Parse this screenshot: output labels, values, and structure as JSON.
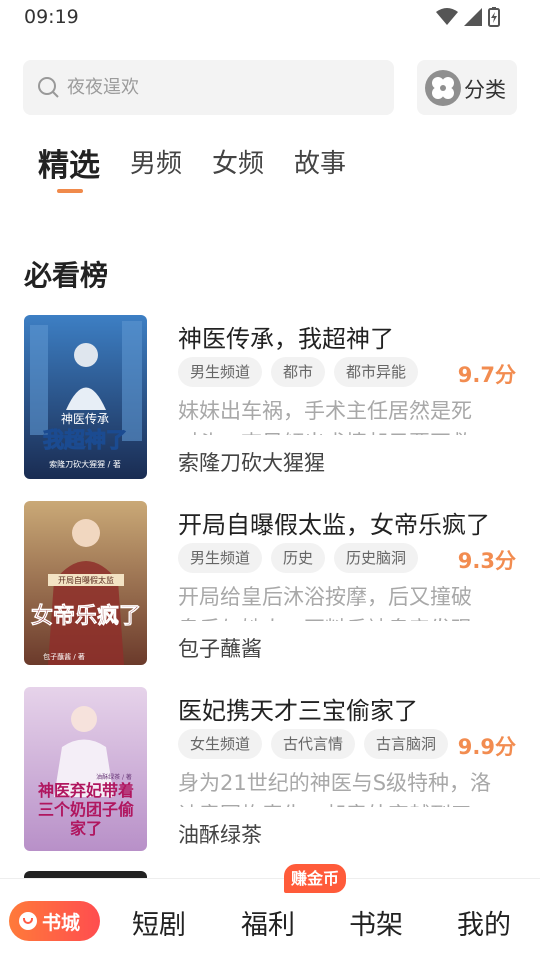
{
  "status_bar": {
    "time": "09:19"
  },
  "search": {
    "placeholder": "夜夜逞欢"
  },
  "category_button": {
    "label": "分类"
  },
  "tabs": [
    {
      "label": "精选"
    },
    {
      "label": "男频"
    },
    {
      "label": "女频"
    },
    {
      "label": "故事"
    }
  ],
  "section": {
    "title": "必看榜"
  },
  "books": [
    {
      "title": "神医传承，我超神了",
      "tags": [
        "男生频道",
        "都市",
        "都市异能"
      ],
      "score": "9.7分",
      "desc_line1": "妹妹出车祸，手术主任居然是死",
      "desc_line2": "对头，李风倾出求情却只要不救",
      "author": "索隆刀砍大猩猩",
      "cover_title": "我超神了",
      "cover_subtitle": "神医传承",
      "cover_author": "索隆刀砍大猩猩 / 著"
    },
    {
      "title": "开局自曝假太监，女帝乐疯了",
      "tags": [
        "男生频道",
        "历史",
        "历史脑洞"
      ],
      "score": "9.3分",
      "desc_line1": "开局给皇后沐浴按摩，后又撞破",
      "desc_line2": "皇后与她人，不料反被皇帝发现",
      "author": "包子蘸酱",
      "cover_title": "女帝乐疯了",
      "cover_subtitle": "开局自曝假太监",
      "cover_author": "包子蘸酱 / 著"
    },
    {
      "title": "医妃携天才三宝偷家了",
      "tags": [
        "女生频道",
        "古代言情",
        "古言脑洞"
      ],
      "score": "9.9分",
      "desc_line1": "身为21世纪的神医与S级特种，洛",
      "desc_line2": "诗意因炸毒失，却意外穿越到了",
      "author": "油酥绿茶",
      "cover_title": "神医弃妃带着三个奶团子偷家了",
      "cover_subtitle": "",
      "cover_author": "油酥绿茶 / 著"
    }
  ],
  "bottom_nav": {
    "home_label": "书城",
    "items": [
      "短剧",
      "福利",
      "书架",
      "我的"
    ],
    "badge": "赚金币"
  }
}
